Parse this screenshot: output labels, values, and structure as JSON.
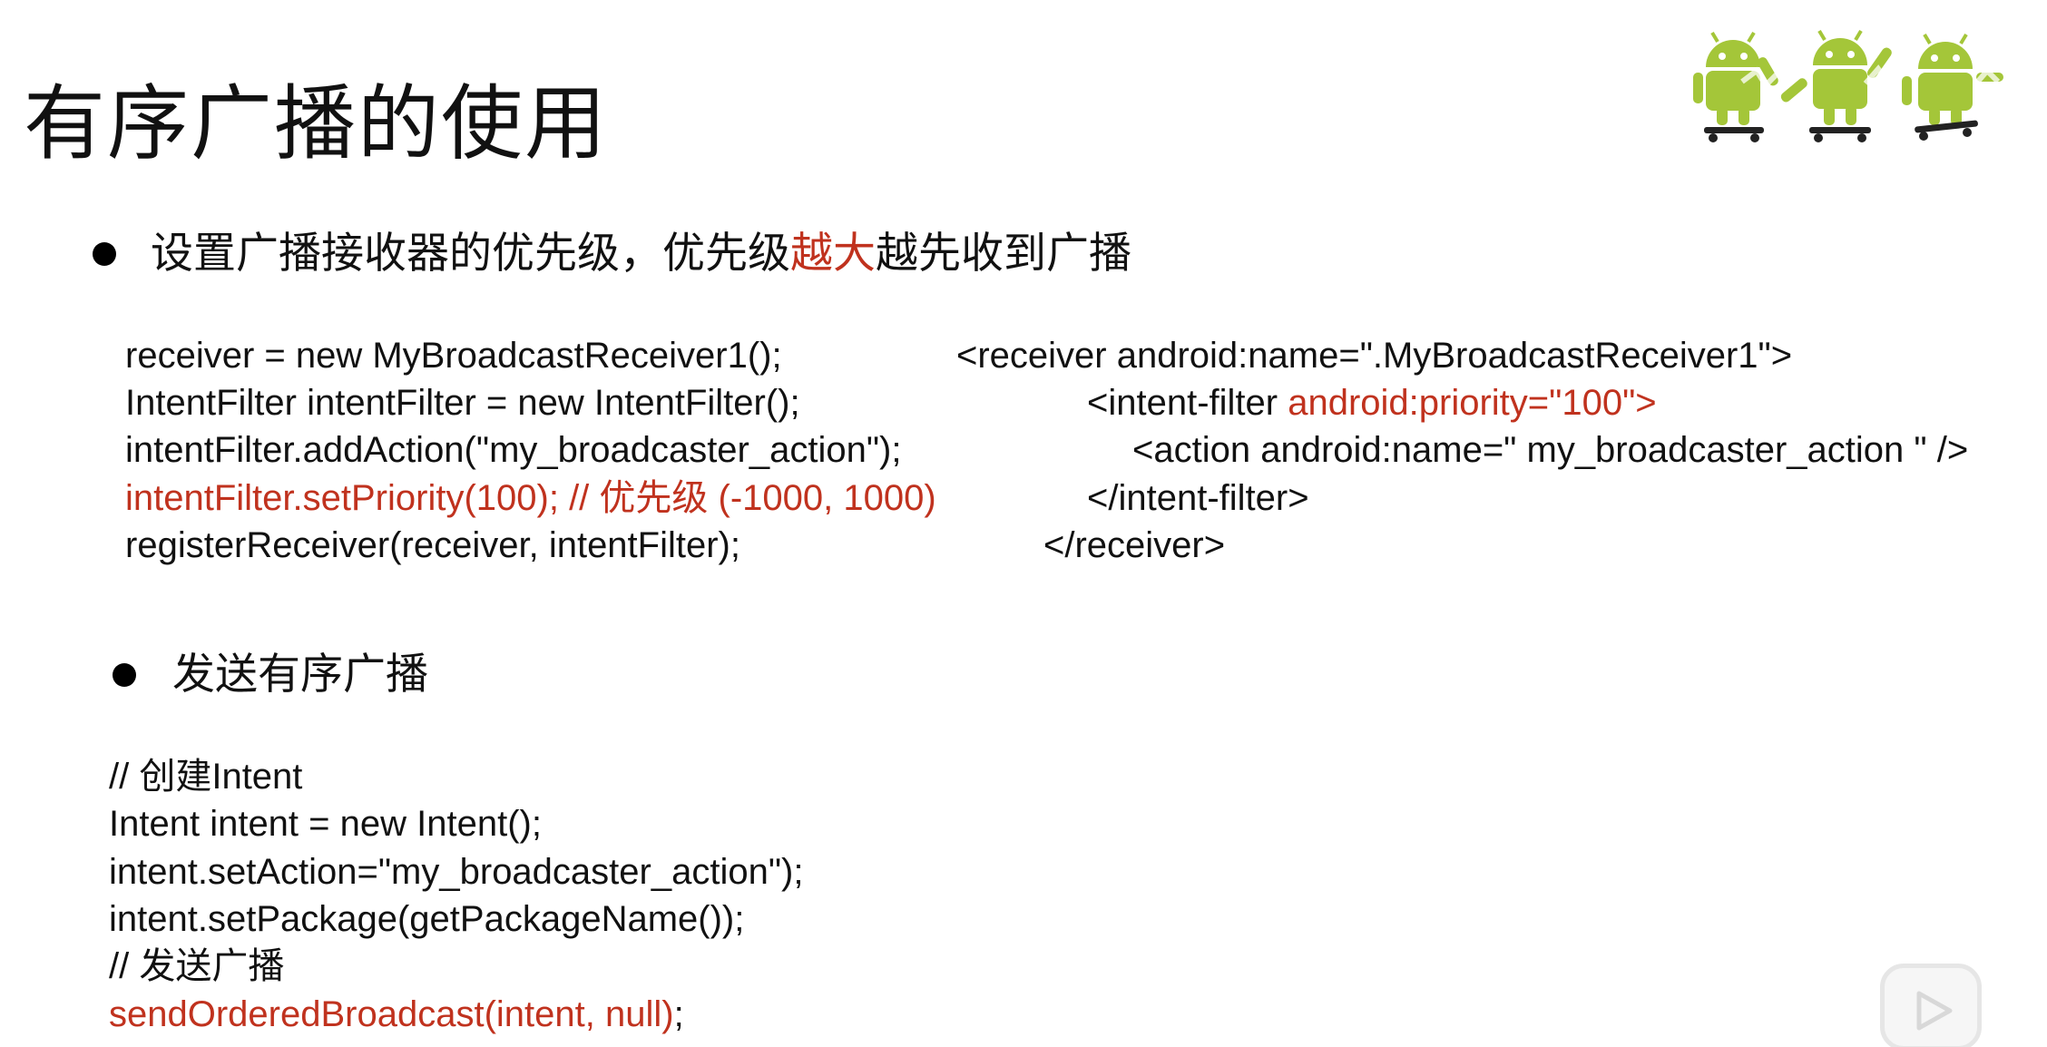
{
  "slide": {
    "title": "有序广播的使用",
    "bullet1": {
      "prefix": "设置广播接收器的优先级，优先级",
      "highlight": "越大",
      "suffix": "越先收到广播"
    },
    "java_code": [
      "receiver = new MyBroadcastReceiver1();",
      "IntentFilter intentFilter = new IntentFilter();",
      "intentFilter.addAction(\"my_broadcaster_action\");",
      "intentFilter.setPriority(100); // 优先级 (-1000, 1000)",
      "registerReceiver(receiver, intentFilter);"
    ],
    "xml_code": {
      "line1": "<receiver android:name=\".MyBroadcastReceiver1\">",
      "line2_prefix": "<intent-filter ",
      "line2_highlight": "android:priority=\"100\">",
      "line3": "<action android:name=\" my_broadcaster_action \" />",
      "line4": "</intent-filter>",
      "line5": "</receiver>"
    },
    "bullet2": "发送有序广播",
    "send_code": {
      "line1": "// 创建Intent",
      "line2": "Intent intent = new Intent();",
      "line3": "intent.setAction=\"my_broadcaster_action\");",
      "line4": "intent.setPackage(getPackageName());",
      "line5": "// 发送广播",
      "line6_highlight": "sendOrderedBroadcast(intent, null)",
      "line6_suffix": ";"
    }
  },
  "decor": {
    "logo_icon": "android-skateboard-logo-icon",
    "watermark_icon": "bilibili-watermark-icon",
    "player_icon": "play-icon"
  },
  "colors": {
    "highlight": "#c0321e",
    "android_green": "#a4c639",
    "text": "#111111"
  }
}
